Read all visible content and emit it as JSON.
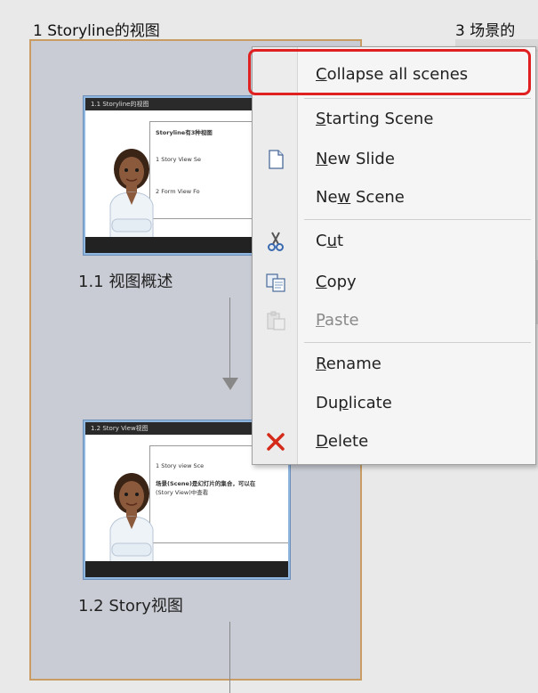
{
  "scene1": {
    "title": "1 Storyline的视图"
  },
  "scene3": {
    "title": "3 场景的"
  },
  "slides": [
    {
      "label": "1.1 视图概述",
      "bar_text": "1.1 Storyline的视图",
      "lines": [
        "Storyline有3种视图",
        "1  Story View      Se",
        "2  Form View      Fo"
      ]
    },
    {
      "label": "1.2 Story视图",
      "bar_text": "1.2 Story View视图",
      "lines": [
        "1  Story view      Sce",
        "场景(Scene)是幻灯片的集合，可以在",
        "(Story View)中查看"
      ]
    }
  ],
  "context_menu": {
    "items": [
      {
        "pre": "",
        "u": "C",
        "post": "ollapse all scenes",
        "icon": "",
        "enabled": true
      },
      {
        "pre": "",
        "u": "S",
        "post": "tarting Scene",
        "icon": "",
        "enabled": true
      },
      {
        "pre": "",
        "u": "N",
        "post": "ew Slide",
        "icon": "new-slide-icon",
        "enabled": true
      },
      {
        "pre": "Ne",
        "u": "w",
        "post": " Scene",
        "icon": "",
        "enabled": true
      },
      {
        "pre": "C",
        "u": "u",
        "post": "t",
        "icon": "cut-icon",
        "enabled": true
      },
      {
        "pre": "",
        "u": "C",
        "post": "opy",
        "icon": "copy-icon",
        "enabled": true
      },
      {
        "pre": "",
        "u": "P",
        "post": "aste",
        "icon": "paste-icon",
        "enabled": false
      },
      {
        "pre": "",
        "u": "R",
        "post": "ename",
        "icon": "",
        "enabled": true
      },
      {
        "pre": "Du",
        "u": "p",
        "post": "licate",
        "icon": "",
        "enabled": true
      },
      {
        "pre": "",
        "u": "D",
        "post": "elete",
        "icon": "delete-icon",
        "enabled": true
      }
    ],
    "highlighted_item": "Collapse all scenes",
    "highlight_color": "#e02020"
  },
  "colors": {
    "panel_border": "#c99c63",
    "panel_bg": "#c9ccd4",
    "thumb_border": "#8fb7e0"
  }
}
